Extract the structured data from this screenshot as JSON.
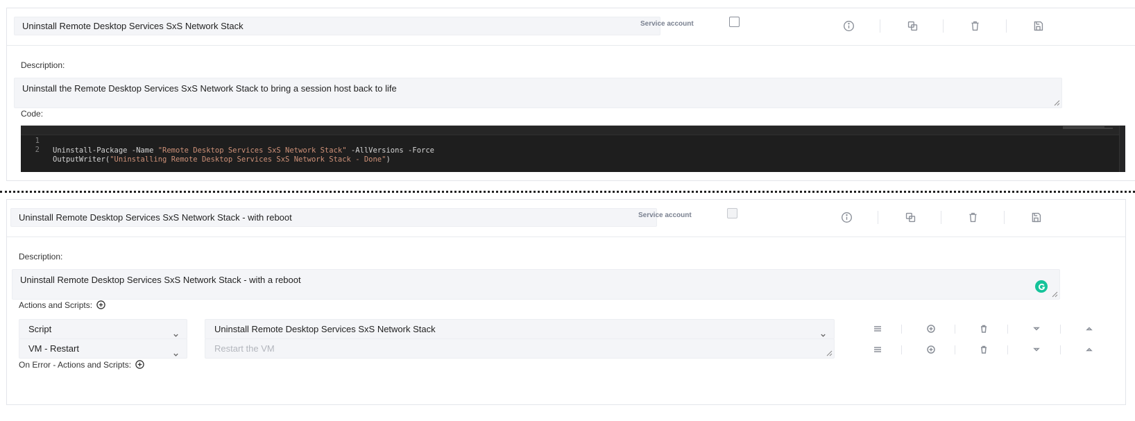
{
  "card1": {
    "name": "Uninstall Remote Desktop Services SxS Network Stack",
    "service_account_label": "Service account",
    "description_label": "Description:",
    "description": "Uninstall the Remote Desktop Services SxS Network Stack to bring a session host back to life",
    "code_label": "Code:",
    "code": {
      "lines": [
        {
          "num": "1",
          "before": "Uninstall-Package -Name ",
          "string": "\"Remote Desktop Services SxS Network Stack\"",
          "after": " -AllVersions -Force"
        },
        {
          "num": "2",
          "before": "OutputWriter(",
          "string": "\"Uninstalling Remote Desktop Services SxS Network Stack - Done\"",
          "after": ")"
        }
      ]
    }
  },
  "card2": {
    "name": "Uninstall Remote Desktop Services SxS Network Stack - with reboot",
    "service_account_label": "Service account",
    "description_label": "Description:",
    "description": "Uninstall Remote Desktop Services SxS Network Stack - with a reboot",
    "actions_label": "Actions and Scripts:",
    "on_error_label": "On Error - Actions and Scripts:",
    "actions": [
      {
        "type": "Script",
        "value": "Uninstall Remote Desktop Services SxS Network Stack",
        "placeholder": ""
      },
      {
        "type": "VM - Restart",
        "value": "",
        "placeholder": "Restart the VM"
      }
    ]
  },
  "icons": {
    "info": "info-icon",
    "copy": "copy-icon",
    "delete": "trash-icon",
    "save": "save-icon",
    "drag": "drag-handle-icon",
    "add": "plus-circle-icon",
    "down": "move-down-icon",
    "up": "move-up-icon"
  },
  "colors": {
    "code_bg": "#1e1e1e",
    "code_string": "#ce9178",
    "input_bg": "#f4f5f8",
    "icon": "#8a8f98",
    "grammarly": "#15c39a"
  }
}
